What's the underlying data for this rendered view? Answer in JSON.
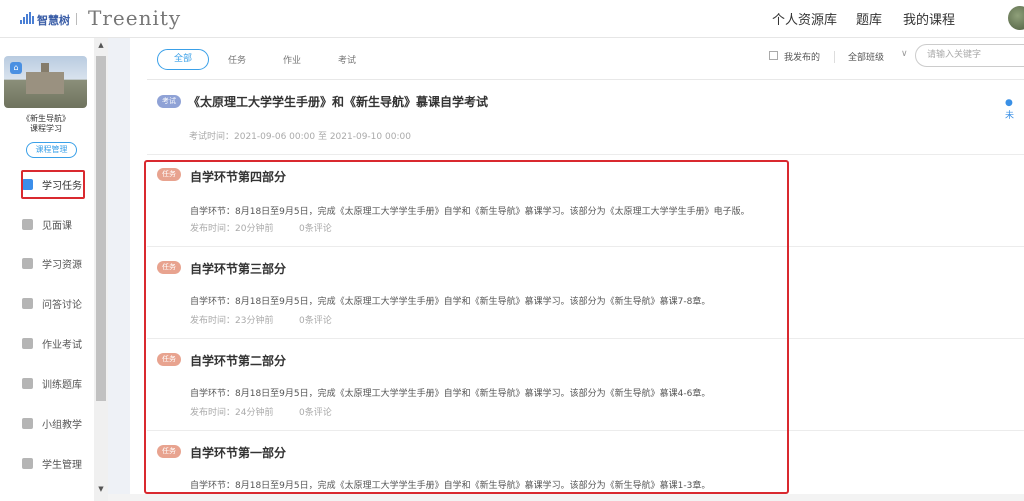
{
  "header": {
    "logo_text": "智慧树",
    "brand": "Treenity",
    "nav": [
      "个人资源库",
      "题库",
      "我的课程"
    ]
  },
  "sidebar": {
    "course_name_line1": "《新生导航》",
    "course_name_line2": "课程学习",
    "manage_label": "课程管理",
    "items": [
      {
        "label": "学习任务",
        "active": true
      },
      {
        "label": "见面课"
      },
      {
        "label": "学习资源"
      },
      {
        "label": "问答讨论"
      },
      {
        "label": "作业考试"
      },
      {
        "label": "训练题库"
      },
      {
        "label": "小组教学"
      },
      {
        "label": "学生管理"
      }
    ]
  },
  "filters": {
    "tabs": [
      "全部",
      "任务",
      "作业",
      "考试"
    ],
    "mine_label": "我发布的",
    "class_select": "全部班级",
    "search_placeholder": "请输入关键字"
  },
  "items": [
    {
      "badge": "考试",
      "title": "《太原理工大学学生手册》和《新生导航》慕课自学考试",
      "meta": "考试时间：2021-09-06 00:00 至 2021-09-10 00:00",
      "status": "● 未"
    },
    {
      "badge": "任务",
      "title": "自学环节第四部分",
      "desc": "自学环节：8月18日至9月5日，完成《太原理工大学学生手册》自学和《新生导航》慕课学习。该部分为《太原理工大学学生手册》电子版。",
      "publish": "发布时间：20分钟前",
      "comments": "0条评论"
    },
    {
      "badge": "任务",
      "title": "自学环节第三部分",
      "desc": "自学环节：8月18日至9月5日，完成《太原理工大学学生手册》自学和《新生导航》慕课学习。该部分为《新生导航》慕课7-8章。",
      "publish": "发布时间：23分钟前",
      "comments": "0条评论"
    },
    {
      "badge": "任务",
      "title": "自学环节第二部分",
      "desc": "自学环节：8月18日至9月5日，完成《太原理工大学学生手册》自学和《新生导航》慕课学习。该部分为《新生导航》慕课4-6章。",
      "publish": "发布时间：24分钟前",
      "comments": "0条评论"
    },
    {
      "badge": "任务",
      "title": "自学环节第一部分",
      "desc": "自学环节：8月18日至9月5日，完成《太原理工大学学生手册》自学和《新生导航》慕课学习。该部分为《新生导航》慕课1-3章。"
    }
  ]
}
